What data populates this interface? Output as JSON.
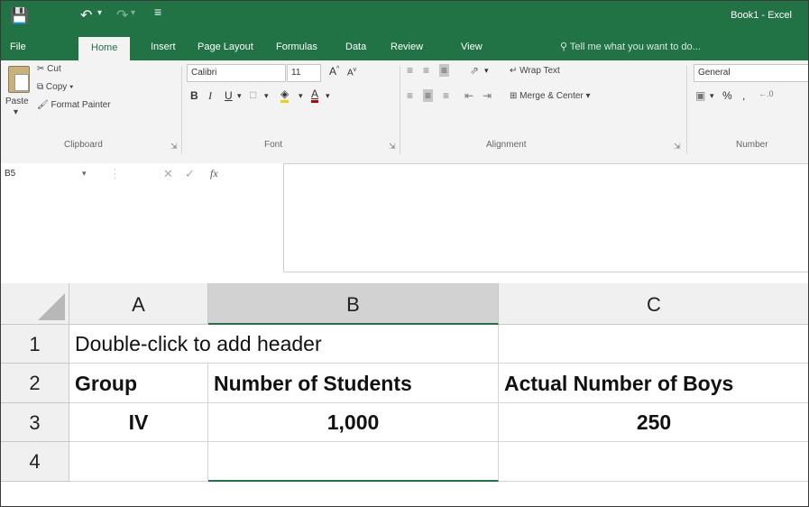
{
  "title_bar": {
    "window_title": "Book1 - Excel",
    "qat_more": "≡"
  },
  "tabs": [
    "File",
    "Home",
    "Insert",
    "Page Layout",
    "Formulas",
    "Data",
    "Review",
    "View"
  ],
  "active_tab": "Home",
  "tell_me": "Tell me what you want to do...",
  "ribbon": {
    "clipboard": {
      "paste": "Paste",
      "cut": "Cut",
      "copy": "Copy",
      "format_painter": "Format Painter",
      "group_label": "Clipboard"
    },
    "font": {
      "font_name": "Calibri",
      "font_size": "11",
      "group_label": "Font"
    },
    "alignment": {
      "wrap_text": "Wrap Text",
      "merge_center": "Merge & Center",
      "group_label": "Alignment"
    },
    "number": {
      "format": "General",
      "percent": "%",
      "comma": ",",
      "group_label": "Number"
    }
  },
  "formula_bar": {
    "name_box": "B5",
    "fx": "fx",
    "value": ""
  },
  "grid": {
    "columns": [
      "A",
      "B",
      "C"
    ],
    "selected_column": "B",
    "rows": [
      "1",
      "2",
      "3",
      "4"
    ],
    "cells": {
      "A1": "Double-click to add header",
      "A2": "Group",
      "B2": "Number of Students",
      "C2": "Actual Number of Boys",
      "A3": "IV",
      "B3": "1,000",
      "C3": "250"
    }
  },
  "colors": {
    "excel_green": "#217346",
    "ribbon_bg": "#f3f3f3",
    "header_bg": "#f0f0f0",
    "selected_header_bg": "#d2d2d2"
  }
}
